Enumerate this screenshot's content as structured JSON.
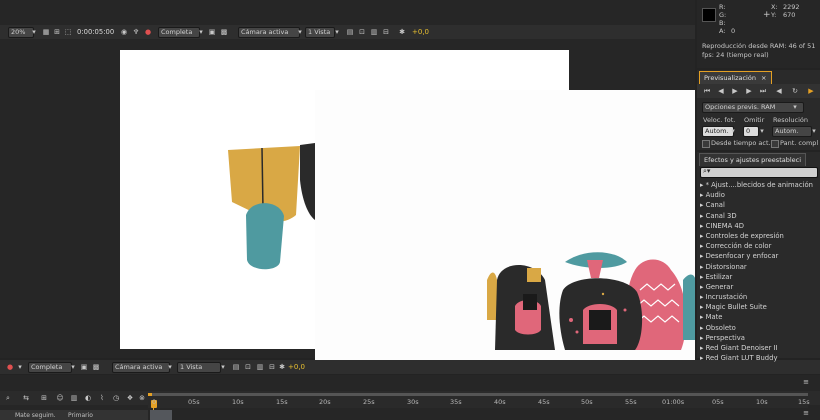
{
  "viewer_top": {
    "zoom": "20%",
    "timecode": "0:00:05:00",
    "resolution": "Completa",
    "camera": "Cámara activa",
    "views": "1 Vista",
    "exposure": "+0,0"
  },
  "info": {
    "r_label": "R:",
    "g_label": "G:",
    "b_label": "B:",
    "a_label": "A:",
    "a_value": "0",
    "x_label": "X:",
    "x_value": "2292",
    "y_label": "Y:",
    "y_value": "670",
    "ram_status": "Reproducción desde RAM: 46 of 51",
    "fps_status": "fps: 24 (tiempo real)"
  },
  "preview": {
    "tab_label": "Previsualización",
    "options_select": "Opciones previs. RAM",
    "frame_rate_label": "Veloc. fot.",
    "skip_label": "Omitir",
    "resolution_label": "Resolución",
    "frame_rate_value": "Autom.",
    "skip_value": "0",
    "resolution_value": "Autom.",
    "from_current_label": "Desde tiempo act.",
    "fullscreen_label": "Pant. compl"
  },
  "effects": {
    "tab_label": "Efectos y ajustes preestableci",
    "search_placeholder": "",
    "items": [
      "* Ajust....blecidos de animación",
      "Audio",
      "Canal",
      "Canal 3D",
      "CINEMA 4D",
      "Controles de expresión",
      "Corrección de color",
      "Desenfocar y enfocar",
      "Distorsionar",
      "Estilizar",
      "Generar",
      "Incrustación",
      "Magic Bullet Suite",
      "Mate",
      "Obsoleto",
      "Perspectiva",
      "Red Giant Denoiser II",
      "Red Giant LUT Buddy"
    ]
  },
  "viewer_bottom": {
    "resolution": "Completa",
    "camera": "Cámara activa",
    "views": "1 Vista",
    "exposure": "+0,0"
  },
  "timeline": {
    "track_matte": "Mate seguim.",
    "parent": "Primario",
    "ticks": [
      "0",
      "05s",
      "10s",
      "15s",
      "20s",
      "25s",
      "30s",
      "35s",
      "40s",
      "45s",
      "50s",
      "55s",
      "01:00s",
      "05s",
      "10s",
      "15s"
    ]
  },
  "colors": {
    "accent": "#e4a024",
    "exposure_text": "#e8c030",
    "mustard": "#d9a845",
    "teal": "#4f9aa0",
    "pink": "#e0677a",
    "dark": "#2a2a2a"
  }
}
